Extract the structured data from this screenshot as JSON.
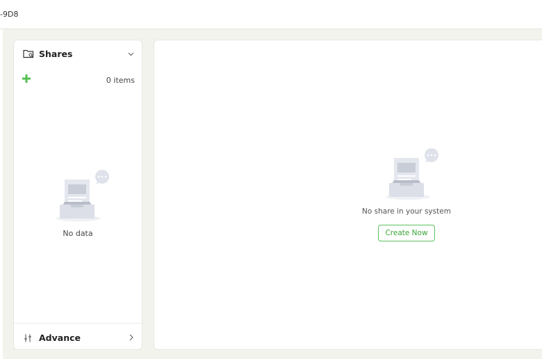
{
  "header": {
    "title": "-9D8"
  },
  "sidebar": {
    "icon": "folder-search-icon",
    "title": "Shares",
    "collapse_icon": "chevron-down-icon",
    "add_icon": "plus-icon",
    "items_count": "0 items",
    "empty_text": "No data",
    "footer": {
      "icon": "sliders-icon",
      "label": "Advance",
      "arrow_icon": "chevron-right-icon"
    }
  },
  "main": {
    "empty_message": "No share in your system",
    "create_button_label": "Create Now"
  },
  "colors": {
    "accent_green": "#5cc05c",
    "background": "#f2f3ec",
    "panel": "#ffffff"
  }
}
